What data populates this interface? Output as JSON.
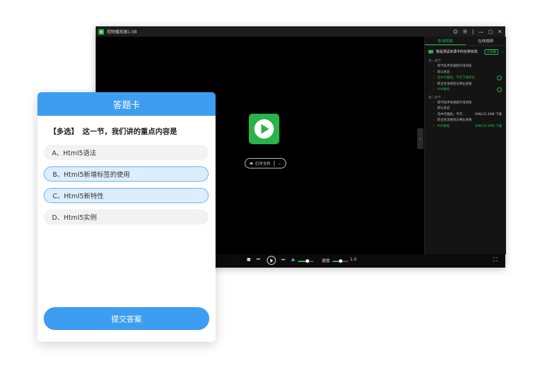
{
  "player": {
    "app_title": "视频播放器1.08",
    "window_controls": [
      "user-icon",
      "menu-icon",
      "minimize-icon",
      "maximize-icon",
      "close-icon"
    ],
    "open_file_label": "打开文件",
    "controls": {
      "speed_label": "速度",
      "speed_value": "1.0",
      "volume_level": 0.6,
      "speed_level": 0.5
    },
    "panel": {
      "tabs": [
        "本地视频",
        "在线视频"
      ],
      "active_tab": 0,
      "folder": {
        "name": "我是测试目录中的名称状态",
        "badge": "已收藏"
      },
      "sections": [
        {
          "title": "第一章节",
          "items": [
            {
              "label": "新代技术快速提升培训班",
              "meta": "",
              "highlight": false
            },
            {
              "label": "默认状态",
              "meta": "",
              "highlight": false
            },
            {
              "label": "选中可播放，不可下载状态",
              "meta": "",
              "highlight": true
            },
            {
              "label": "职业生涯规划与事业发展",
              "meta": "",
              "highlight": false
            },
            {
              "label": "PHP教程",
              "meta": "",
              "highlight": true
            }
          ]
        },
        {
          "title": "第二章节",
          "items": [
            {
              "label": "新代技术快速提升培训班",
              "meta": "",
              "highlight": false
            },
            {
              "label": "默认状态",
              "meta": "",
              "highlight": false
            },
            {
              "label": "选中可播放，不可…",
              "meta": "0MB/15.6MB  下载",
              "highlight": false
            },
            {
              "label": "职业生涯规划与事业发展",
              "meta": "",
              "highlight": false
            },
            {
              "label": "PHP教程",
              "meta": "0MB/15.6MB  下载",
              "highlight": true
            }
          ]
        }
      ]
    }
  },
  "card": {
    "title": "答题卡",
    "question_tag": "【多选】",
    "question_text": "这一节，我们讲的重点内容是",
    "options": [
      {
        "label": "A、Html5语法",
        "selected": false
      },
      {
        "label": "B、Html5新增标签的使用",
        "selected": true
      },
      {
        "label": "C、Html5新特性",
        "selected": true
      },
      {
        "label": "D、Html5实例",
        "selected": false
      }
    ],
    "submit_label": "提交答案"
  },
  "colors": {
    "accent_green": "#2bb24c",
    "card_blue": "#3d9df0",
    "selected_bg": "#dcedfc"
  }
}
